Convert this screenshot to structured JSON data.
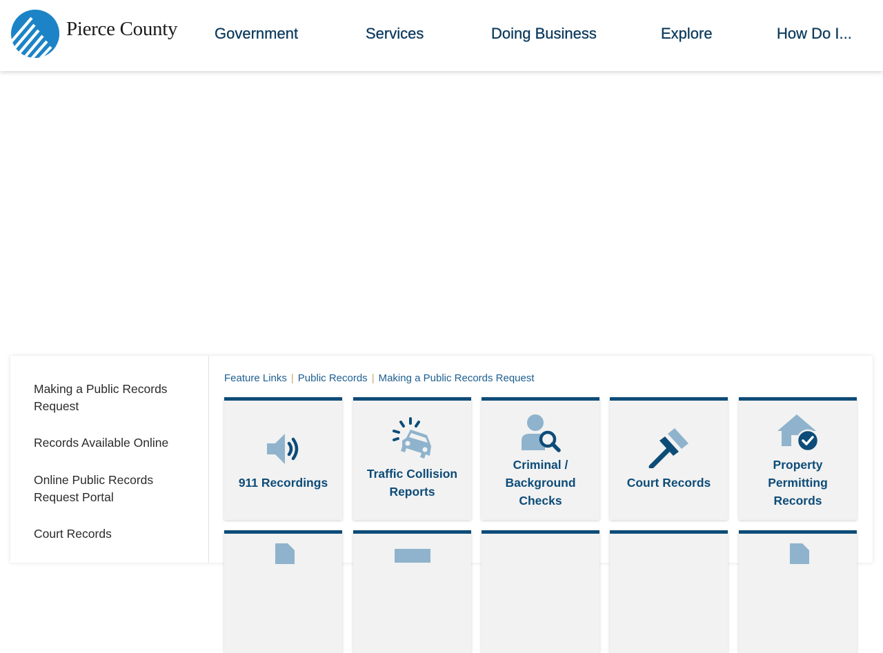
{
  "brand": {
    "name": "Pierce County",
    "logo_icon": "mountain-stripes-logo",
    "color": "#0d3a5c",
    "accent": "#1c84c6"
  },
  "nav": {
    "items": [
      {
        "label": "Government"
      },
      {
        "label": "Services"
      },
      {
        "label": "Doing Business"
      },
      {
        "label": "Explore"
      },
      {
        "label": "How Do I..."
      }
    ]
  },
  "sidebar": {
    "links": [
      {
        "label": "Making a Public Records Request"
      },
      {
        "label": "Records Available Online"
      },
      {
        "label": "Online Public Records Request Portal"
      },
      {
        "label": "Court Records"
      }
    ]
  },
  "breadcrumb": {
    "items": [
      {
        "label": "Feature Links"
      },
      {
        "label": "Public Records"
      },
      {
        "label": "Making a Public Records Request"
      }
    ],
    "separator": "|"
  },
  "tiles": [
    {
      "label": "911 Recordings",
      "icon": "speaker-icon"
    },
    {
      "label": "Traffic Collision Reports",
      "icon": "car-crash-icon"
    },
    {
      "label": "Criminal / Background Checks",
      "icon": "person-search-icon"
    },
    {
      "label": "Court Records",
      "icon": "gavel-icon"
    },
    {
      "label": "Property Permitting Records",
      "icon": "house-check-icon"
    }
  ],
  "colors": {
    "tile_bg": "#f2f2f2",
    "tile_border": "#0d4c78",
    "icon_light": "#8fb3cc",
    "icon_dark": "#0d4c78"
  }
}
